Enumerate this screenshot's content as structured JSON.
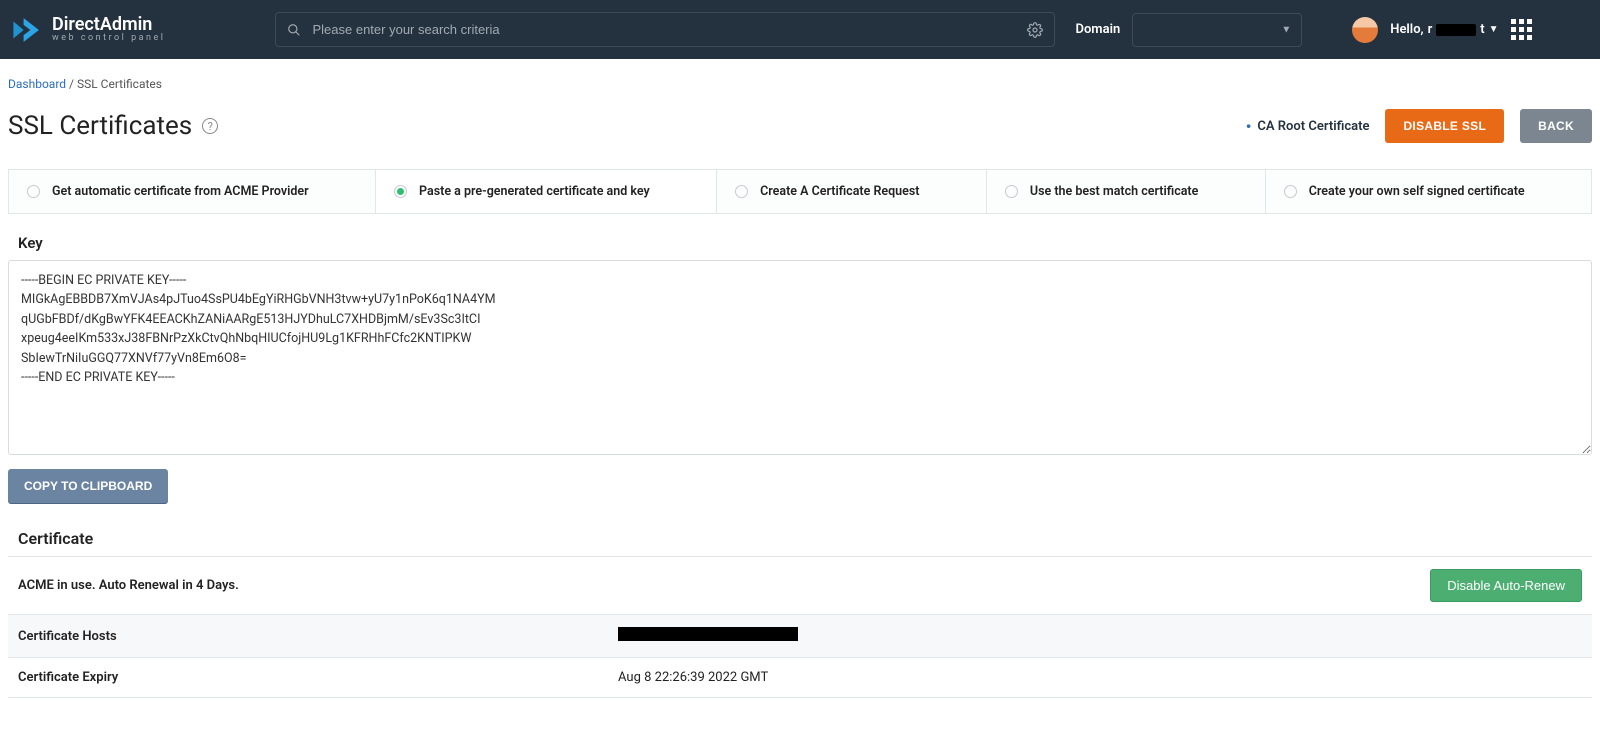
{
  "header": {
    "logo_main": "DirectAdmin",
    "logo_sub": "web control panel",
    "search_placeholder": "Please enter your search criteria",
    "domain_label": "Domain",
    "hello_prefix": "Hello, "
  },
  "breadcrumb": {
    "dashboard": "Dashboard",
    "sep": " / ",
    "current": "SSL Certificates"
  },
  "title": "SSL Certificates",
  "actions": {
    "ca_root": "CA Root Certificate",
    "disable_ssl": "DISABLE SSL",
    "back": "BACK"
  },
  "tabs": [
    "Get automatic certificate from ACME Provider",
    "Paste a pre-generated certificate and key",
    "Create A Certificate Request",
    "Use the best match certificate",
    "Create your own self signed certificate"
  ],
  "key": {
    "label": "Key",
    "value": "-----BEGIN EC PRIVATE KEY-----\nMIGkAgEBBDB7XmVJAs4pJTuo4SsPU4bEgYiRHGbVNH3tvw+yU7y1nPoK6q1NA4YM\nqUGbFBDf/dKgBwYFK4EEACKhZANiAARgE513HJYDhuLC7XHDBjmM/sEv3Sc3ItCI\nxpeug4eeIKm533xJ38FBNrPzXkCtvQhNbqHIUCfojHU9Lg1KFRHhFCfc2KNTIPKW\nSbIewTrNiIuGGQ77XNVf77yVn8Em6O8=\n-----END EC PRIVATE KEY-----",
    "copy": "COPY TO CLIPBOARD"
  },
  "cert": {
    "label": "Certificate",
    "acme_row": "ACME in use. Auto Renewal in 4 Days.",
    "disable_auto": "Disable Auto-Renew",
    "hosts_label": "Certificate Hosts",
    "expiry_label": "Certificate Expiry",
    "expiry_value": "Aug 8 22:26:39 2022 GMT"
  }
}
